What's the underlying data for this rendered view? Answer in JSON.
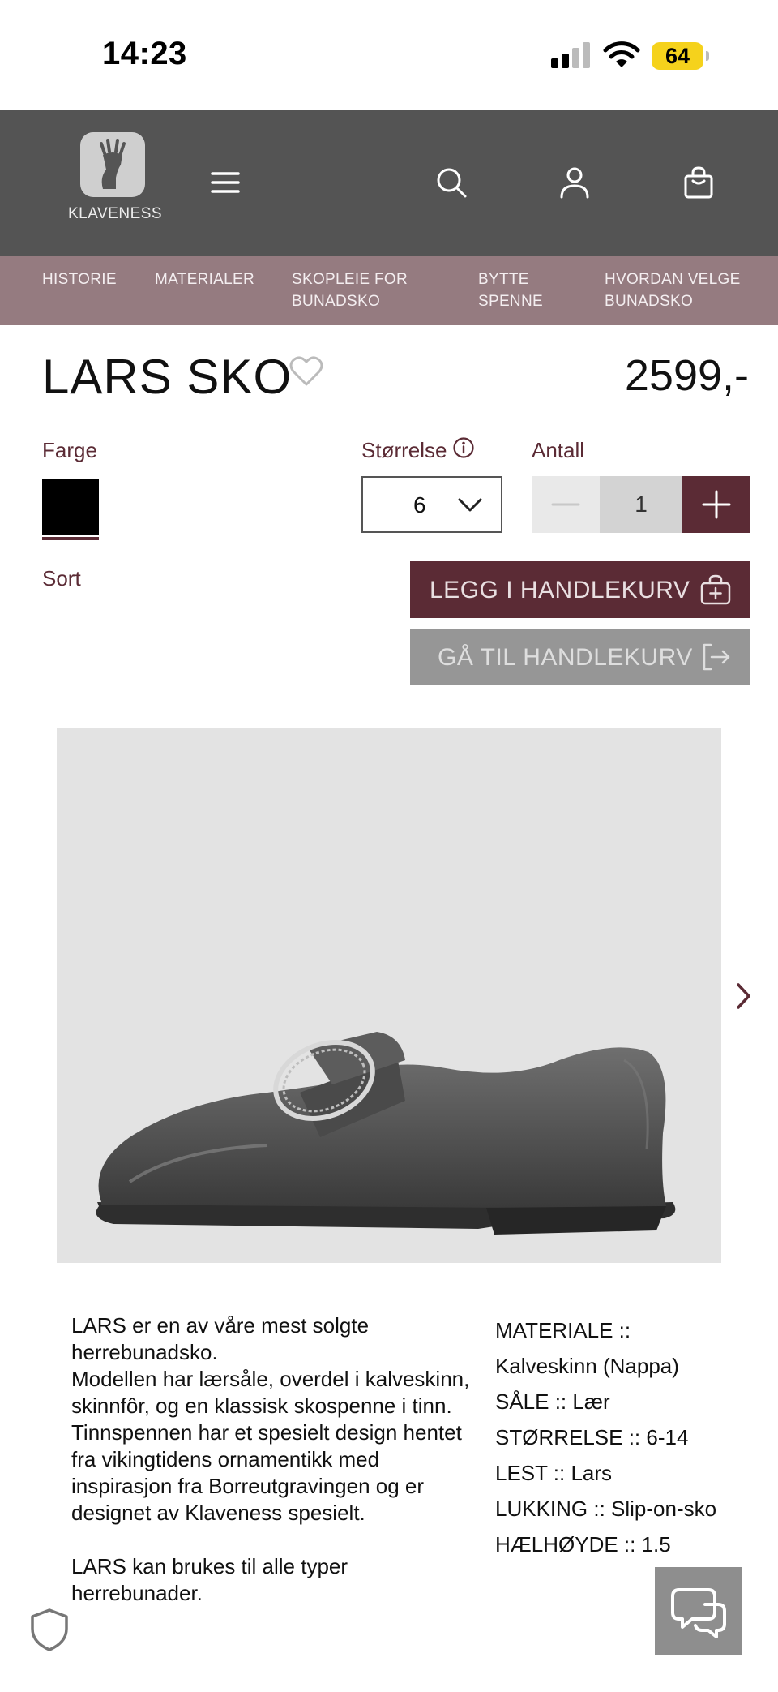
{
  "status_bar": {
    "time": "14:23",
    "battery": "64"
  },
  "header": {
    "logo_text": "KLAVENESS",
    "icons": [
      "menu-icon",
      "search-icon",
      "user-icon",
      "bag-icon"
    ]
  },
  "nav": {
    "items": [
      {
        "line1": "HISTORIE",
        "line2": ""
      },
      {
        "line1": "MATERIALER",
        "line2": ""
      },
      {
        "line1": "SKOPLEIE FOR",
        "line2": "BUNADSKO"
      },
      {
        "line1": "BYTTE",
        "line2": "SPENNE"
      },
      {
        "line1": "HVORDAN VELGE",
        "line2": "BUNADSKO"
      }
    ]
  },
  "product": {
    "title": "LARS SKO",
    "price": "2599,-",
    "color_label": "Farge",
    "color_value": "Sort",
    "size_label": "Størrelse",
    "size_value": "6",
    "qty_label": "Antall",
    "qty_value": "1",
    "add_to_cart": "LEGG I HANDLEKURV",
    "go_to_cart": "GÅ TIL HANDLEKURV"
  },
  "description": {
    "paragraphs": [
      "LARS er en av våre mest solgte herrebunadsko.",
      "Modellen har lærsåle, overdel i kalveskinn, skinnfôr, og en klassisk skospenne i tinn.",
      "Tinnspennen har et spesielt design hentet fra vikingtidens ornamentikk med inspirasjon fra Borreutgravingen og er designet av Klaveness spesielt.",
      "LARS kan brukes til alle typer herrebunader."
    ]
  },
  "specs": [
    "MATERIALE :: Kalveskinn (Nappa)",
    "SÅLE :: Lær",
    "STØRRELSE :: 6-14",
    "LEST :: Lars",
    "LUKKING :: Slip-on-sko",
    "HÆLHØYDE :: 1.5"
  ],
  "colors": {
    "accent": "#5b2b35",
    "header_bg": "#545454",
    "nav_bg": "#957b80",
    "disabled_bg": "#969696"
  }
}
